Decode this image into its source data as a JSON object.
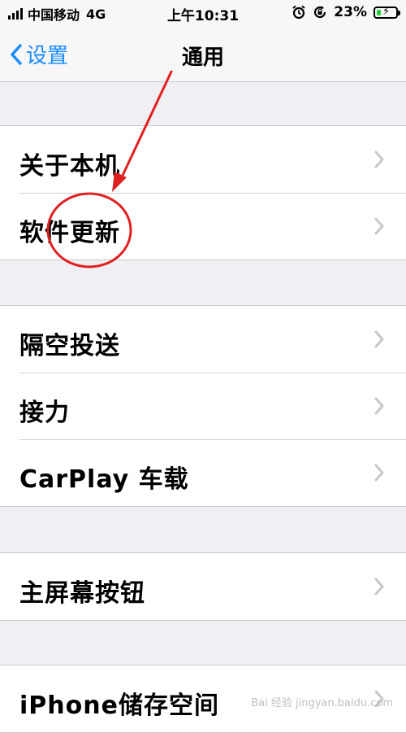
{
  "status_bar": {
    "carrier": "中国移动",
    "network": "4G",
    "time": "上午10:31",
    "battery_percent": "23%",
    "battery_level": 0.23,
    "icons": [
      "signal-bars-icon",
      "alarm-icon",
      "orientation-lock-icon",
      "battery-charging-icon"
    ]
  },
  "nav": {
    "back_label": "设置",
    "title": "通用"
  },
  "groups": [
    {
      "rows": [
        {
          "label": "关于本机"
        },
        {
          "label": "软件更新"
        }
      ]
    },
    {
      "rows": [
        {
          "label": "隔空投送"
        },
        {
          "label": "接力"
        },
        {
          "label": "CarPlay 车载"
        }
      ]
    },
    {
      "rows": [
        {
          "label": "主屏幕按钮"
        }
      ]
    },
    {
      "rows": [
        {
          "label": "iPhone储存空间"
        }
      ]
    }
  ],
  "annotation": {
    "color": "#e02020"
  },
  "colors": {
    "accent": "#1a8cff",
    "background": "#efeff4",
    "chevron": "#c7c7cc"
  },
  "watermark": "Bai 经验 jingyan.baidu.com"
}
